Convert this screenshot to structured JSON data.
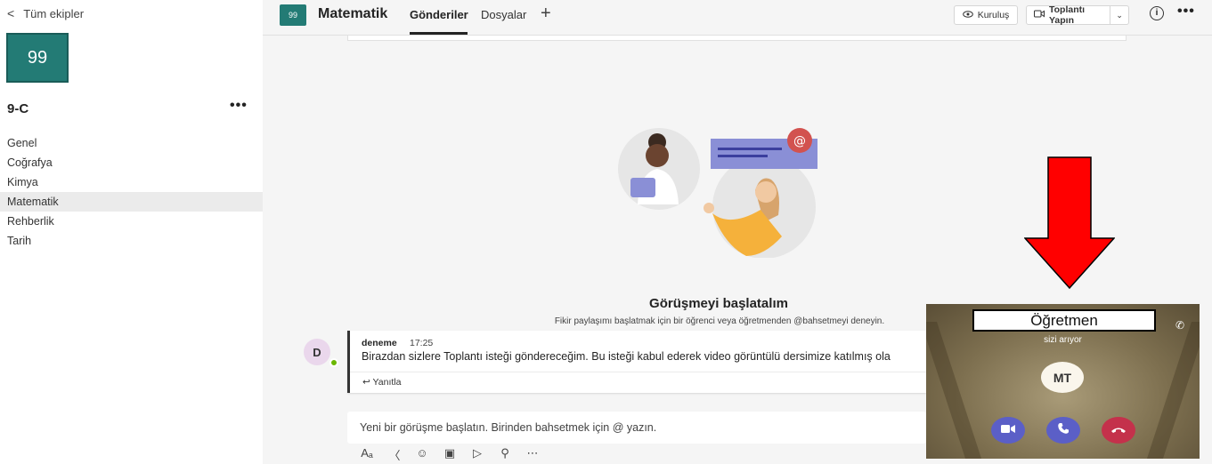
{
  "sidebar": {
    "back_label": "Tüm ekipler",
    "team_avatar": "99",
    "team_name": "9-C",
    "more": "•••",
    "channels": [
      {
        "label": "Genel"
      },
      {
        "label": "Coğrafya"
      },
      {
        "label": "Kimya"
      },
      {
        "label": "Matematik",
        "active": true
      },
      {
        "label": "Rehberlik"
      },
      {
        "label": "Tarih"
      }
    ]
  },
  "header": {
    "avatar": "99",
    "title": "Matematik",
    "tabs": [
      {
        "label": "Gönderiler",
        "active": true
      },
      {
        "label": "Dosyalar"
      }
    ],
    "add": "+",
    "org_label": "Kuruluş",
    "meet_label": "Toplantı Yapın",
    "info": "i",
    "more": "•••"
  },
  "empty_state": {
    "title": "Görüşmeyi başlatalım",
    "subtitle": "Fikir paylaşımı başlatmak için bir öğrenci veya öğretmenden @bahsetmeyi deneyin."
  },
  "message": {
    "avatar": "D",
    "author": "deneme",
    "time": "17:25",
    "text": "Birazdan sizlere Toplantı isteği göndereceğim. Bu isteği kabul ederek video görüntülü dersimize katılmış ola",
    "reply_label": "Yanıtla"
  },
  "compose": {
    "placeholder": "Yeni bir görüşme başlatın. Birinden bahsetmek için @ yazın."
  },
  "call": {
    "caller": "Öğretmen",
    "status": "sizi arıyor",
    "initials": "MT"
  },
  "colors": {
    "team_accent": "#237b75",
    "call_accept": "#5b5fc7",
    "call_decline": "#c4314b",
    "annotation_arrow": "#ff0000"
  }
}
